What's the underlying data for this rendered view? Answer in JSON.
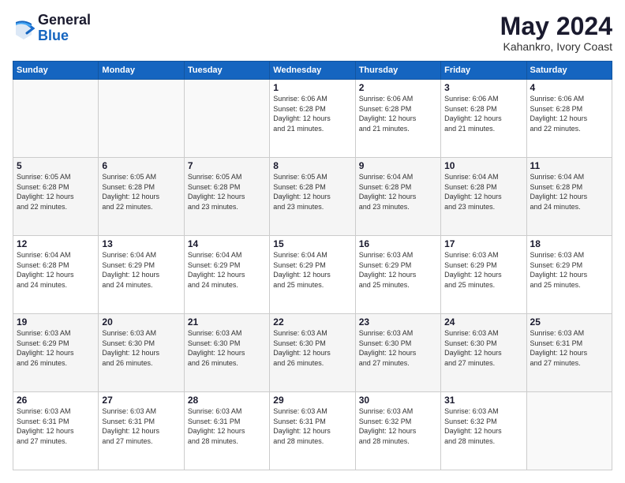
{
  "logo": {
    "line1": "General",
    "line2": "Blue"
  },
  "title": "May 2024",
  "location": "Kahankro, Ivory Coast",
  "weekdays": [
    "Sunday",
    "Monday",
    "Tuesday",
    "Wednesday",
    "Thursday",
    "Friday",
    "Saturday"
  ],
  "weeks": [
    [
      {
        "day": "",
        "info": ""
      },
      {
        "day": "",
        "info": ""
      },
      {
        "day": "",
        "info": ""
      },
      {
        "day": "1",
        "info": "Sunrise: 6:06 AM\nSunset: 6:28 PM\nDaylight: 12 hours\nand 21 minutes."
      },
      {
        "day": "2",
        "info": "Sunrise: 6:06 AM\nSunset: 6:28 PM\nDaylight: 12 hours\nand 21 minutes."
      },
      {
        "day": "3",
        "info": "Sunrise: 6:06 AM\nSunset: 6:28 PM\nDaylight: 12 hours\nand 21 minutes."
      },
      {
        "day": "4",
        "info": "Sunrise: 6:06 AM\nSunset: 6:28 PM\nDaylight: 12 hours\nand 22 minutes."
      }
    ],
    [
      {
        "day": "5",
        "info": "Sunrise: 6:05 AM\nSunset: 6:28 PM\nDaylight: 12 hours\nand 22 minutes."
      },
      {
        "day": "6",
        "info": "Sunrise: 6:05 AM\nSunset: 6:28 PM\nDaylight: 12 hours\nand 22 minutes."
      },
      {
        "day": "7",
        "info": "Sunrise: 6:05 AM\nSunset: 6:28 PM\nDaylight: 12 hours\nand 23 minutes."
      },
      {
        "day": "8",
        "info": "Sunrise: 6:05 AM\nSunset: 6:28 PM\nDaylight: 12 hours\nand 23 minutes."
      },
      {
        "day": "9",
        "info": "Sunrise: 6:04 AM\nSunset: 6:28 PM\nDaylight: 12 hours\nand 23 minutes."
      },
      {
        "day": "10",
        "info": "Sunrise: 6:04 AM\nSunset: 6:28 PM\nDaylight: 12 hours\nand 23 minutes."
      },
      {
        "day": "11",
        "info": "Sunrise: 6:04 AM\nSunset: 6:28 PM\nDaylight: 12 hours\nand 24 minutes."
      }
    ],
    [
      {
        "day": "12",
        "info": "Sunrise: 6:04 AM\nSunset: 6:28 PM\nDaylight: 12 hours\nand 24 minutes."
      },
      {
        "day": "13",
        "info": "Sunrise: 6:04 AM\nSunset: 6:29 PM\nDaylight: 12 hours\nand 24 minutes."
      },
      {
        "day": "14",
        "info": "Sunrise: 6:04 AM\nSunset: 6:29 PM\nDaylight: 12 hours\nand 24 minutes."
      },
      {
        "day": "15",
        "info": "Sunrise: 6:04 AM\nSunset: 6:29 PM\nDaylight: 12 hours\nand 25 minutes."
      },
      {
        "day": "16",
        "info": "Sunrise: 6:03 AM\nSunset: 6:29 PM\nDaylight: 12 hours\nand 25 minutes."
      },
      {
        "day": "17",
        "info": "Sunrise: 6:03 AM\nSunset: 6:29 PM\nDaylight: 12 hours\nand 25 minutes."
      },
      {
        "day": "18",
        "info": "Sunrise: 6:03 AM\nSunset: 6:29 PM\nDaylight: 12 hours\nand 25 minutes."
      }
    ],
    [
      {
        "day": "19",
        "info": "Sunrise: 6:03 AM\nSunset: 6:29 PM\nDaylight: 12 hours\nand 26 minutes."
      },
      {
        "day": "20",
        "info": "Sunrise: 6:03 AM\nSunset: 6:30 PM\nDaylight: 12 hours\nand 26 minutes."
      },
      {
        "day": "21",
        "info": "Sunrise: 6:03 AM\nSunset: 6:30 PM\nDaylight: 12 hours\nand 26 minutes."
      },
      {
        "day": "22",
        "info": "Sunrise: 6:03 AM\nSunset: 6:30 PM\nDaylight: 12 hours\nand 26 minutes."
      },
      {
        "day": "23",
        "info": "Sunrise: 6:03 AM\nSunset: 6:30 PM\nDaylight: 12 hours\nand 27 minutes."
      },
      {
        "day": "24",
        "info": "Sunrise: 6:03 AM\nSunset: 6:30 PM\nDaylight: 12 hours\nand 27 minutes."
      },
      {
        "day": "25",
        "info": "Sunrise: 6:03 AM\nSunset: 6:31 PM\nDaylight: 12 hours\nand 27 minutes."
      }
    ],
    [
      {
        "day": "26",
        "info": "Sunrise: 6:03 AM\nSunset: 6:31 PM\nDaylight: 12 hours\nand 27 minutes."
      },
      {
        "day": "27",
        "info": "Sunrise: 6:03 AM\nSunset: 6:31 PM\nDaylight: 12 hours\nand 27 minutes."
      },
      {
        "day": "28",
        "info": "Sunrise: 6:03 AM\nSunset: 6:31 PM\nDaylight: 12 hours\nand 28 minutes."
      },
      {
        "day": "29",
        "info": "Sunrise: 6:03 AM\nSunset: 6:31 PM\nDaylight: 12 hours\nand 28 minutes."
      },
      {
        "day": "30",
        "info": "Sunrise: 6:03 AM\nSunset: 6:32 PM\nDaylight: 12 hours\nand 28 minutes."
      },
      {
        "day": "31",
        "info": "Sunrise: 6:03 AM\nSunset: 6:32 PM\nDaylight: 12 hours\nand 28 minutes."
      },
      {
        "day": "",
        "info": ""
      }
    ]
  ]
}
